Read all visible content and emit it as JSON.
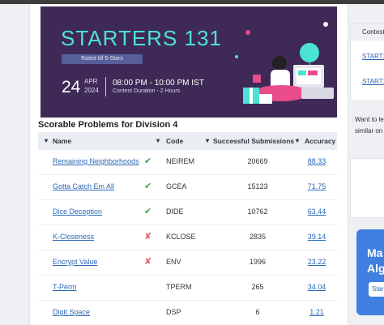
{
  "banner": {
    "title": "STARTERS 131",
    "rated": "Rated till 5-Stars",
    "day": "24",
    "month": "APR",
    "year": "2024",
    "time": "08:00 PM - 10:00 PM IST",
    "duration": "Contest Duration - 2 Hours"
  },
  "section_title": "Scorable Problems for Division 4",
  "table": {
    "headers": {
      "name": "Name",
      "code": "Code",
      "submissions": "Successful Submissions",
      "accuracy": "Accuracy"
    },
    "rows": [
      {
        "name": "Remaining Neighborhoods",
        "status": "✔",
        "code": "NEIREM",
        "submissions": "20669",
        "accuracy": "88.33"
      },
      {
        "name": "Gotta Catch Em All",
        "status": "✔",
        "code": "GCEA",
        "submissions": "15123",
        "accuracy": "71.75"
      },
      {
        "name": "Dice Deception",
        "status": "✔",
        "code": "DIDE",
        "submissions": "10762",
        "accuracy": "63.44"
      },
      {
        "name": "K-Closeness",
        "status": "✘",
        "code": "KCLOSE",
        "submissions": "2835",
        "accuracy": "39.14"
      },
      {
        "name": "Encrypt Value",
        "status": "✘",
        "code": "ENV",
        "submissions": "1996",
        "accuracy": "23.22"
      },
      {
        "name": "T-Perm",
        "status": "",
        "code": "TPERM",
        "submissions": "265",
        "accuracy": "34.04"
      },
      {
        "name": "Digit Space",
        "status": "",
        "code": "DSP",
        "submissions": "6",
        "accuracy": "1.21"
      }
    ]
  },
  "right": {
    "contest_header": "Contest",
    "links": [
      "START1",
      "START1"
    ],
    "text1": "Want to le",
    "text2": "similar on",
    "ad_line1": "Ma",
    "ad_line2": "Alg",
    "ad_button": "Star"
  },
  "colors": {
    "banner_bg": "#3f2a57",
    "accent": "#4be3d3",
    "link": "#2a67b5",
    "success": "#3aa655",
    "fail": "#e06666"
  }
}
